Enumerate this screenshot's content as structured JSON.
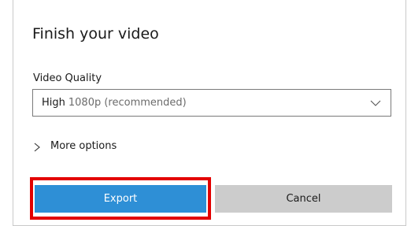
{
  "dialog": {
    "title": "Finish your video",
    "quality_label": "Video Quality",
    "quality_select": {
      "value_main": "High",
      "value_sub": "1080p (recommended)",
      "icon": "chevron-down-icon"
    },
    "more_options": {
      "label": "More options",
      "icon": "chevron-right-icon"
    },
    "buttons": {
      "export_label": "Export",
      "cancel_label": "Cancel"
    }
  },
  "colors": {
    "export_button": "#2e8fd6",
    "cancel_button": "#cccccc",
    "highlight": "#e30000"
  }
}
